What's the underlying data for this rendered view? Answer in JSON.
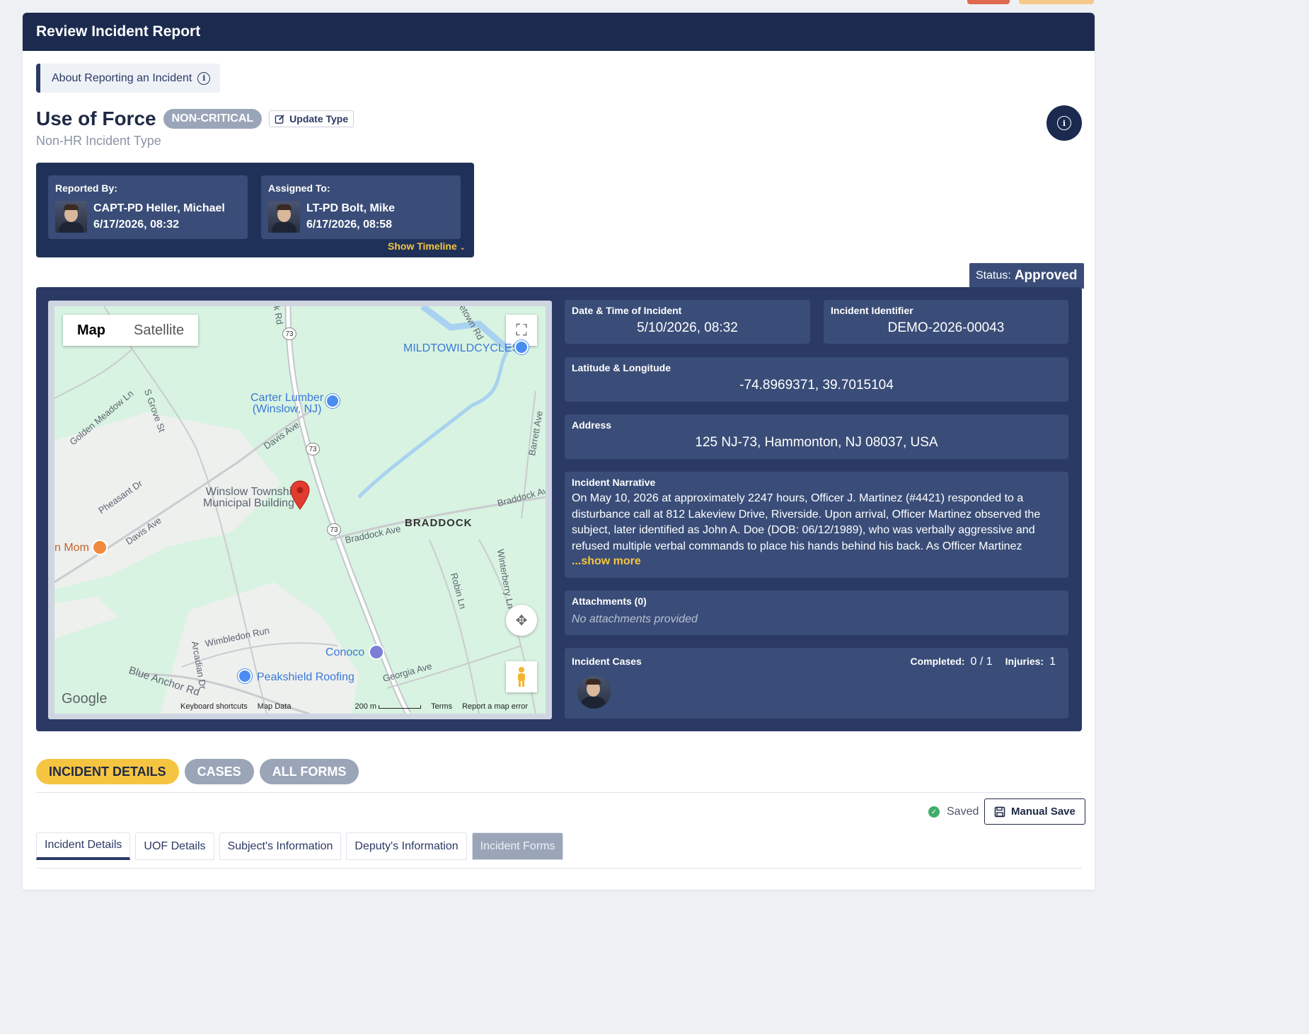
{
  "header": {
    "title": "Review Incident Report"
  },
  "about": {
    "label": "About Reporting an Incident"
  },
  "incident": {
    "type": "Use of Force",
    "severity": "NON-CRITICAL",
    "update_type_label": "Update Type",
    "subtype": "Non-HR Incident Type"
  },
  "people": {
    "reported_by": {
      "label": "Reported By:",
      "name": "CAPT-PD Heller, Michael",
      "datetime": "6/17/2026, 08:32"
    },
    "assigned_to": {
      "label": "Assigned To:",
      "name": "LT-PD Bolt, Mike",
      "datetime": "6/17/2026, 08:58"
    },
    "show_timeline": "Show Timeline"
  },
  "status": {
    "label": "Status:",
    "value": "Approved"
  },
  "map": {
    "toggle": [
      "Map",
      "Satellite"
    ],
    "labels": {
      "mildtowild": "MILDTOWILDCYCLES",
      "carter1": "Carter Lumber",
      "carter2": "(Winslow, NJ)",
      "winslow1": "Winslow Townshi",
      "winslow2": "Municipal Building",
      "braddock": "BRADDOCK",
      "mom": "n Mom",
      "conoco": "Conoco",
      "peakshield": "Peakshield Roofing",
      "golden": "Golden Meadow Ln",
      "sgrove": "S Grove St",
      "davis1": "Davis Ave",
      "davis2": "Davis Ave",
      "pheasant": "Pheasant Dr",
      "braddock_ave1": "Braddock Ave",
      "braddock_ave2": "Braddock Av",
      "barrett": "Barrett Ave",
      "robin": "Robin Ln",
      "winterberry": "Winterberry Ln",
      "wimbledon": "Wimbledon Run",
      "arcadian": "Arcadian Dr",
      "blueanchor": "Blue Anchor Rd",
      "georgia": "Georgia Ave",
      "krd": "k Rd",
      "etown": "etown Rd",
      "route": "73"
    },
    "google": "Google",
    "footer": {
      "shortcuts": "Keyboard shortcuts",
      "data": "Map Data",
      "scale": "200 m",
      "terms": "Terms",
      "report": "Report a map error"
    }
  },
  "details": {
    "datetime": {
      "label": "Date & Time of Incident",
      "value": "5/10/2026, 08:32"
    },
    "identifier": {
      "label": "Incident Identifier",
      "value": "DEMO-2026-00043"
    },
    "latlng": {
      "label": "Latitude & Longitude",
      "value": "-74.8969371, 39.7015104"
    },
    "address": {
      "label": "Address",
      "value": "125 NJ-73, Hammonton, NJ 08037, USA"
    },
    "narrative": {
      "label": "Incident Narrative",
      "text": "On May 10, 2026 at approximately 2247 hours, Officer J. Martinez (#4421) responded to a disturbance call at 812 Lakeview Drive, Riverside. Upon arrival, Officer Martinez observed the subject, later identified as John A. Doe (DOB: 06/12/1989), who was verbally aggressive and refused multiple verbal commands to place his hands behind his back. As Officer Martinez",
      "show_more": "...show more"
    },
    "attachments": {
      "label": "Attachments (0)",
      "empty": "No attachments provided"
    },
    "cases": {
      "label": "Incident Cases",
      "completed_label": "Completed:",
      "completed_value": "0 / 1",
      "injuries_label": "Injuries:",
      "injuries_value": "1"
    }
  },
  "pills": [
    "INCIDENT DETAILS",
    "CASES",
    "ALL FORMS"
  ],
  "save": {
    "saved": "Saved",
    "manual": "Manual Save"
  },
  "subtabs": [
    "Incident Details",
    "UOF Details",
    "Subject's Information",
    "Deputy's Information",
    "Incident Forms"
  ]
}
